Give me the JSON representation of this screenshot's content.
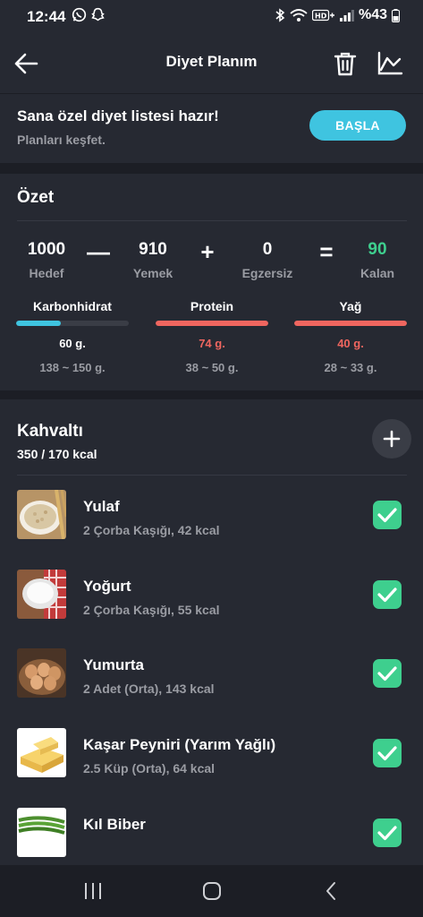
{
  "status_bar": {
    "time": "12:44",
    "battery": "%43",
    "left_icons": [
      "whatsapp-icon",
      "snapchat-icon"
    ],
    "right_icons": [
      "bluetooth-icon",
      "wifi-icon",
      "hd-plus-icon",
      "signal-icon",
      "battery-icon"
    ]
  },
  "app_bar": {
    "title": "Diyet Planım"
  },
  "promo": {
    "title": "Sana özel diyet listesi hazır!",
    "subtitle": "Planları keşfet.",
    "button": "BAŞLA"
  },
  "summary": {
    "title": "Özet",
    "goal": {
      "value": "1000",
      "label": "Hedef"
    },
    "food": {
      "value": "910",
      "label": "Yemek"
    },
    "exercise": {
      "value": "0",
      "label": "Egzersiz"
    },
    "remaining": {
      "value": "90",
      "label": "Kalan"
    },
    "operators": {
      "minus": "—",
      "plus": "+",
      "equals": "="
    },
    "macros": [
      {
        "name": "Karbonhidrat",
        "amount": "60 g.",
        "range": "138 ~ 150 g.",
        "progress": 0.4,
        "bar_color": "#3fc4e0",
        "amount_color": "#ffffff"
      },
      {
        "name": "Protein",
        "amount": "74 g.",
        "range": "38 ~ 50 g.",
        "progress": 1.0,
        "bar_color": "#f0665f",
        "amount_color": "#f0665f"
      },
      {
        "name": "Yağ",
        "amount": "40 g.",
        "range": "28 ~ 33 g.",
        "progress": 1.0,
        "bar_color": "#f0665f",
        "amount_color": "#f0665f"
      }
    ]
  },
  "meal": {
    "title": "Kahvaltı",
    "kcal": "350 / 170 kcal",
    "items": [
      {
        "name": "Yulaf",
        "detail": "2 Çorba Kaşığı, 42 kcal",
        "checked": true
      },
      {
        "name": "Yoğurt",
        "detail": "2 Çorba Kaşığı, 55 kcal",
        "checked": true
      },
      {
        "name": "Yumurta",
        "detail": "2 Adet (Orta), 143 kcal",
        "checked": true
      },
      {
        "name": "Kaşar Peyniri (Yarım Yağlı)",
        "detail": "2.5 Küp (Orta), 64 kcal",
        "checked": true
      },
      {
        "name": "Kıl Biber",
        "detail": "",
        "checked": true
      }
    ]
  },
  "colors": {
    "background": "#1c1e25",
    "card": "#262932",
    "accent_blue": "#3fc4e0",
    "accent_green": "#3ecf8e",
    "accent_red": "#f0665f"
  }
}
